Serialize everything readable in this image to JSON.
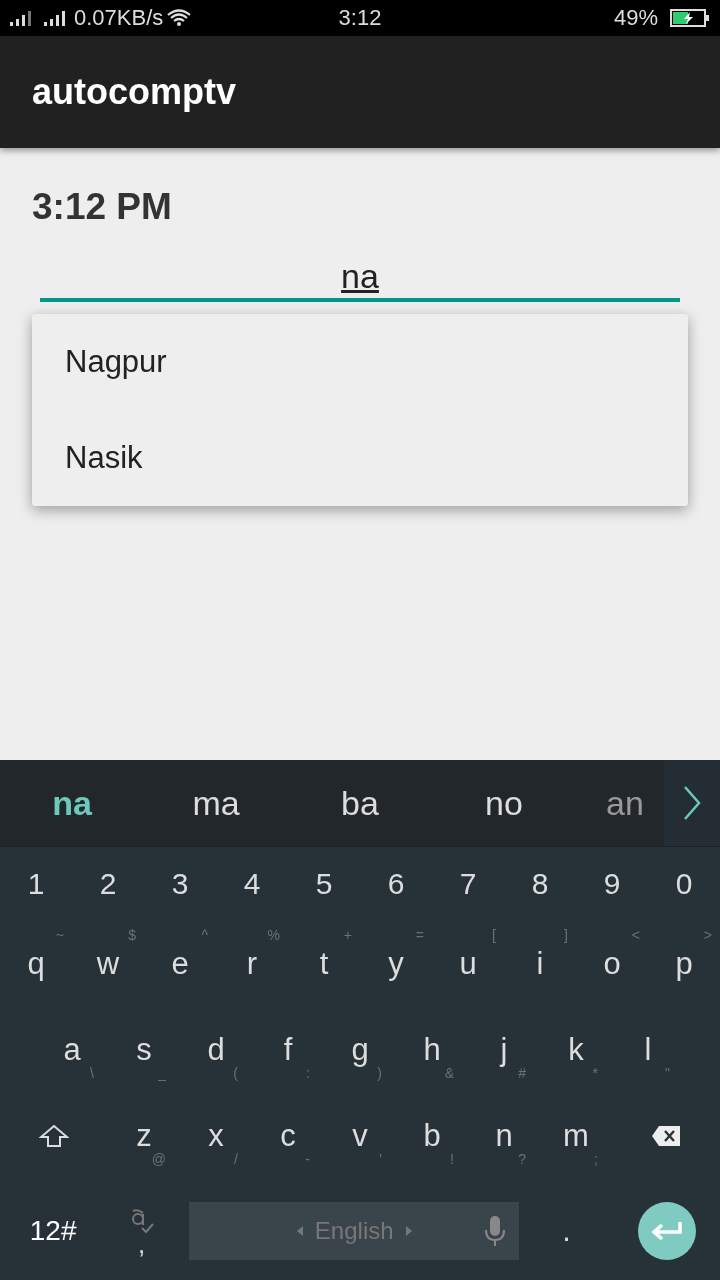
{
  "status_bar": {
    "network_speed": "0.07KB/s",
    "time": "3:12",
    "battery": "49%"
  },
  "app_bar": {
    "title": "autocomptv"
  },
  "clock": "3:12 PM",
  "autocomplete": {
    "value": "na",
    "suggestions": [
      "Nagpur",
      "Nasik"
    ]
  },
  "keyboard": {
    "suggestions": [
      {
        "text": "na",
        "selected": true
      },
      {
        "text": "ma",
        "selected": false
      },
      {
        "text": "ba",
        "selected": false
      },
      {
        "text": "no",
        "selected": false
      },
      {
        "text": "an",
        "selected": false
      }
    ],
    "number_row": [
      "1",
      "2",
      "3",
      "4",
      "5",
      "6",
      "7",
      "8",
      "9",
      "0"
    ],
    "row_1": [
      {
        "label": "q",
        "hint": "~"
      },
      {
        "label": "w",
        "hint": "$"
      },
      {
        "label": "e",
        "hint": "^"
      },
      {
        "label": "r",
        "hint": "%"
      },
      {
        "label": "t",
        "hint": "+"
      },
      {
        "label": "y",
        "hint": "="
      },
      {
        "label": "u",
        "hint": "["
      },
      {
        "label": "i",
        "hint": "]"
      },
      {
        "label": "o",
        "hint": "<"
      },
      {
        "label": "p",
        "hint": ">"
      }
    ],
    "row_2": [
      {
        "label": "a",
        "hint": "\\"
      },
      {
        "label": "s",
        "hint": "_"
      },
      {
        "label": "d",
        "hint": "("
      },
      {
        "label": "f",
        "hint": ":"
      },
      {
        "label": "g",
        "hint": ")"
      },
      {
        "label": "h",
        "hint": "&"
      },
      {
        "label": "j",
        "hint": "#"
      },
      {
        "label": "k",
        "hint": "*"
      },
      {
        "label": "l",
        "hint": "\""
      }
    ],
    "row_3": [
      {
        "label": "z",
        "hint": "@"
      },
      {
        "label": "x",
        "hint": "/"
      },
      {
        "label": "c",
        "hint": "-"
      },
      {
        "label": "v",
        "hint": "'"
      },
      {
        "label": "b",
        "hint": "!"
      },
      {
        "label": "n",
        "hint": "?"
      },
      {
        "label": "m",
        "hint": ";"
      }
    ],
    "symbols_key": "12#",
    "comma_key": ",",
    "space_label": "English",
    "period_key": "."
  }
}
